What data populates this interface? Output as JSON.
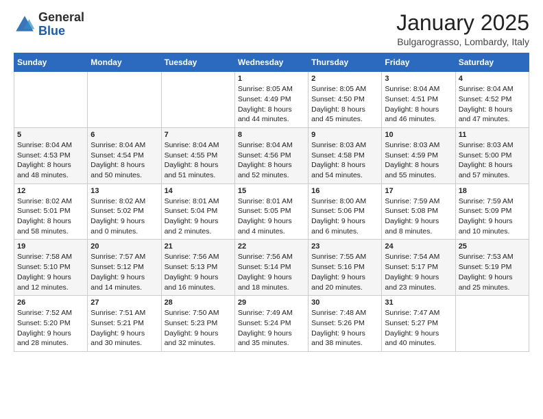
{
  "logo": {
    "general": "General",
    "blue": "Blue"
  },
  "header": {
    "month": "January 2025",
    "location": "Bulgarograsso, Lombardy, Italy"
  },
  "days_of_week": [
    "Sunday",
    "Monday",
    "Tuesday",
    "Wednesday",
    "Thursday",
    "Friday",
    "Saturday"
  ],
  "weeks": [
    [
      {
        "day": "",
        "info": ""
      },
      {
        "day": "",
        "info": ""
      },
      {
        "day": "",
        "info": ""
      },
      {
        "day": "1",
        "info": "Sunrise: 8:05 AM\nSunset: 4:49 PM\nDaylight: 8 hours\nand 44 minutes."
      },
      {
        "day": "2",
        "info": "Sunrise: 8:05 AM\nSunset: 4:50 PM\nDaylight: 8 hours\nand 45 minutes."
      },
      {
        "day": "3",
        "info": "Sunrise: 8:04 AM\nSunset: 4:51 PM\nDaylight: 8 hours\nand 46 minutes."
      },
      {
        "day": "4",
        "info": "Sunrise: 8:04 AM\nSunset: 4:52 PM\nDaylight: 8 hours\nand 47 minutes."
      }
    ],
    [
      {
        "day": "5",
        "info": "Sunrise: 8:04 AM\nSunset: 4:53 PM\nDaylight: 8 hours\nand 48 minutes."
      },
      {
        "day": "6",
        "info": "Sunrise: 8:04 AM\nSunset: 4:54 PM\nDaylight: 8 hours\nand 50 minutes."
      },
      {
        "day": "7",
        "info": "Sunrise: 8:04 AM\nSunset: 4:55 PM\nDaylight: 8 hours\nand 51 minutes."
      },
      {
        "day": "8",
        "info": "Sunrise: 8:04 AM\nSunset: 4:56 PM\nDaylight: 8 hours\nand 52 minutes."
      },
      {
        "day": "9",
        "info": "Sunrise: 8:03 AM\nSunset: 4:58 PM\nDaylight: 8 hours\nand 54 minutes."
      },
      {
        "day": "10",
        "info": "Sunrise: 8:03 AM\nSunset: 4:59 PM\nDaylight: 8 hours\nand 55 minutes."
      },
      {
        "day": "11",
        "info": "Sunrise: 8:03 AM\nSunset: 5:00 PM\nDaylight: 8 hours\nand 57 minutes."
      }
    ],
    [
      {
        "day": "12",
        "info": "Sunrise: 8:02 AM\nSunset: 5:01 PM\nDaylight: 8 hours\nand 58 minutes."
      },
      {
        "day": "13",
        "info": "Sunrise: 8:02 AM\nSunset: 5:02 PM\nDaylight: 9 hours\nand 0 minutes."
      },
      {
        "day": "14",
        "info": "Sunrise: 8:01 AM\nSunset: 5:04 PM\nDaylight: 9 hours\nand 2 minutes."
      },
      {
        "day": "15",
        "info": "Sunrise: 8:01 AM\nSunset: 5:05 PM\nDaylight: 9 hours\nand 4 minutes."
      },
      {
        "day": "16",
        "info": "Sunrise: 8:00 AM\nSunset: 5:06 PM\nDaylight: 9 hours\nand 6 minutes."
      },
      {
        "day": "17",
        "info": "Sunrise: 7:59 AM\nSunset: 5:08 PM\nDaylight: 9 hours\nand 8 minutes."
      },
      {
        "day": "18",
        "info": "Sunrise: 7:59 AM\nSunset: 5:09 PM\nDaylight: 9 hours\nand 10 minutes."
      }
    ],
    [
      {
        "day": "19",
        "info": "Sunrise: 7:58 AM\nSunset: 5:10 PM\nDaylight: 9 hours\nand 12 minutes."
      },
      {
        "day": "20",
        "info": "Sunrise: 7:57 AM\nSunset: 5:12 PM\nDaylight: 9 hours\nand 14 minutes."
      },
      {
        "day": "21",
        "info": "Sunrise: 7:56 AM\nSunset: 5:13 PM\nDaylight: 9 hours\nand 16 minutes."
      },
      {
        "day": "22",
        "info": "Sunrise: 7:56 AM\nSunset: 5:14 PM\nDaylight: 9 hours\nand 18 minutes."
      },
      {
        "day": "23",
        "info": "Sunrise: 7:55 AM\nSunset: 5:16 PM\nDaylight: 9 hours\nand 20 minutes."
      },
      {
        "day": "24",
        "info": "Sunrise: 7:54 AM\nSunset: 5:17 PM\nDaylight: 9 hours\nand 23 minutes."
      },
      {
        "day": "25",
        "info": "Sunrise: 7:53 AM\nSunset: 5:19 PM\nDaylight: 9 hours\nand 25 minutes."
      }
    ],
    [
      {
        "day": "26",
        "info": "Sunrise: 7:52 AM\nSunset: 5:20 PM\nDaylight: 9 hours\nand 28 minutes."
      },
      {
        "day": "27",
        "info": "Sunrise: 7:51 AM\nSunset: 5:21 PM\nDaylight: 9 hours\nand 30 minutes."
      },
      {
        "day": "28",
        "info": "Sunrise: 7:50 AM\nSunset: 5:23 PM\nDaylight: 9 hours\nand 32 minutes."
      },
      {
        "day": "29",
        "info": "Sunrise: 7:49 AM\nSunset: 5:24 PM\nDaylight: 9 hours\nand 35 minutes."
      },
      {
        "day": "30",
        "info": "Sunrise: 7:48 AM\nSunset: 5:26 PM\nDaylight: 9 hours\nand 38 minutes."
      },
      {
        "day": "31",
        "info": "Sunrise: 7:47 AM\nSunset: 5:27 PM\nDaylight: 9 hours\nand 40 minutes."
      },
      {
        "day": "",
        "info": ""
      }
    ]
  ]
}
